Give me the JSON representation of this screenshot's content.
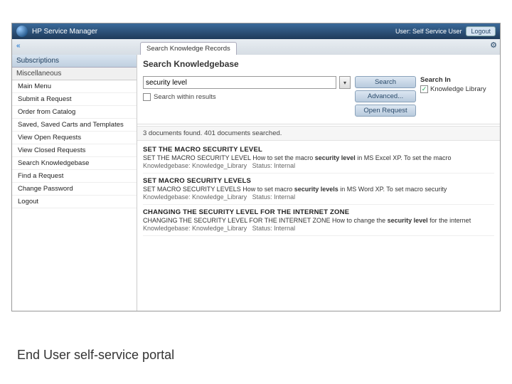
{
  "app": {
    "title": "HP Service Manager",
    "user_label": "User: Self Service User",
    "logout": "Logout"
  },
  "tabs": {
    "active": "Search Knowledge Records"
  },
  "sidebar": {
    "subscriptions": "Subscriptions",
    "misc": "Miscellaneous",
    "items": [
      "Main Menu",
      "Submit a Request",
      "Order from Catalog",
      "Saved, Saved Carts and Templates",
      "View Open Requests",
      "View Closed Requests",
      "Search Knowledgebase",
      "Find a Request",
      "Change Password",
      "Logout"
    ]
  },
  "main": {
    "heading": "Search Knowledgebase",
    "query": "security level",
    "search_within_label": "Search within results",
    "buttons": {
      "search": "Search",
      "advanced": "Advanced...",
      "open": "Open Request"
    },
    "search_in": {
      "title": "Search In",
      "item": "Knowledge Library",
      "checked": "✓"
    },
    "results_meta": "3 documents found. 401 documents searched.",
    "results": [
      {
        "title": "SET THE MACRO SECURITY LEVEL",
        "summary_a": "SET THE MACRO SECURITY LEVEL How to set the macro ",
        "summary_term": "security level",
        "summary_b": " in MS Excel XP. To set the macro",
        "kb": "Knowledgebase: Knowledge_Library",
        "status": "Status: Internal"
      },
      {
        "title": "SET MACRO SECURITY LEVELS",
        "summary_a": "SET MACRO SECURITY LEVELS How to set macro ",
        "summary_term": "security levels",
        "summary_b": " in MS Word XP. To set macro security",
        "kb": "Knowledgebase: Knowledge_Library",
        "status": "Status: Internal"
      },
      {
        "title": "CHANGING THE SECURITY LEVEL FOR THE INTERNET ZONE",
        "summary_a": "CHANGING THE SECURITY LEVEL FOR THE INTERNET ZONE How to change the ",
        "summary_term": "security level",
        "summary_b": " for the internet",
        "kb": "Knowledgebase: Knowledge_Library",
        "status": "Status: Internal"
      }
    ]
  },
  "caption": "End User self-service portal"
}
